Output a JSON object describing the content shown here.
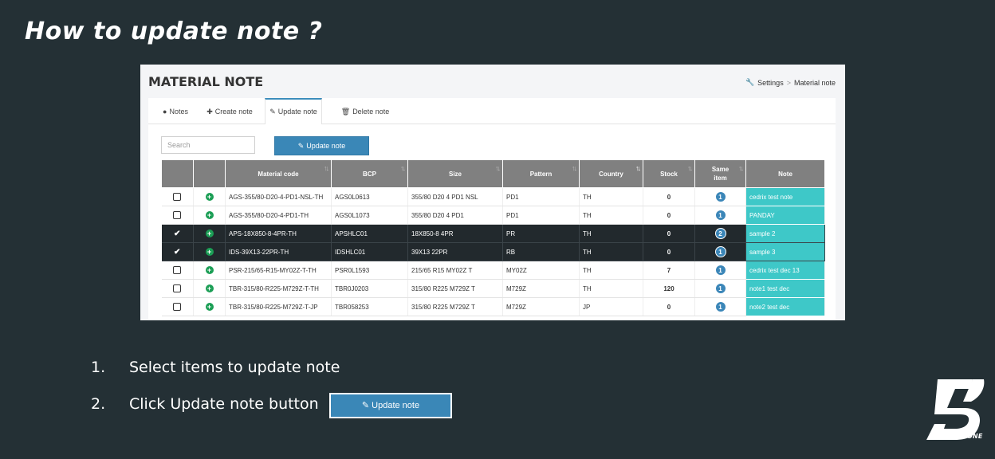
{
  "slide": {
    "title": "How to update note ?",
    "steps": [
      {
        "num": "1.",
        "text": "Select items to update note"
      },
      {
        "num": "2.",
        "text": "Click Update note button"
      }
    ],
    "sample_button_label": "Update note",
    "logo_text": "BRIDGESTONE"
  },
  "app": {
    "page_title": "MATERIAL NOTE",
    "breadcrumb": {
      "root": "Settings",
      "separator": ">",
      "current": "Material note"
    },
    "tabs": [
      {
        "label": "Notes",
        "icon": "comment-icon"
      },
      {
        "label": "Create note",
        "icon": "plus-icon"
      },
      {
        "label": "Update note",
        "icon": "edit-icon"
      },
      {
        "label": "Delete note",
        "icon": "trash-icon"
      }
    ],
    "active_tab": "Update note",
    "search": {
      "placeholder": "Search",
      "value": ""
    },
    "update_button_label": "Update note",
    "columns": [
      "",
      "",
      "Material code",
      "BCP",
      "Size",
      "Pattern",
      "Country",
      "Stock",
      "Same item",
      "Note"
    ],
    "rows": [
      {
        "selected": false,
        "material_code": "AGS-355/80-D20-4-PD1-NSL-TH",
        "bcp": "AGS0L0613",
        "size": "355/80 D20 4 PD1 NSL",
        "pattern": "PD1",
        "country": "TH",
        "stock": "0",
        "same_item": "1",
        "note": "cedrix test note"
      },
      {
        "selected": false,
        "material_code": "AGS-355/80-D20-4-PD1-TH",
        "bcp": "AGS0L1073",
        "size": "355/80 D20 4 PD1",
        "pattern": "PD1",
        "country": "TH",
        "stock": "0",
        "same_item": "1",
        "note": "PANDAY"
      },
      {
        "selected": true,
        "material_code": "APS-18X850-8-4PR-TH",
        "bcp": "APSHLC01",
        "size": "18X850-8 4PR",
        "pattern": "PR",
        "country": "TH",
        "stock": "0",
        "same_item": "2",
        "note": "sample 2"
      },
      {
        "selected": true,
        "material_code": "IDS-39X13-22PR-TH",
        "bcp": "IDSHLC01",
        "size": "39X13 22PR",
        "pattern": "RB",
        "country": "TH",
        "stock": "0",
        "same_item": "1",
        "note": "sample 3"
      },
      {
        "selected": false,
        "material_code": "PSR-215/65-R15-MY02Z-T-TH",
        "bcp": "PSR0L1593",
        "size": "215/65 R15 MY02Z T",
        "pattern": "MY02Z",
        "country": "TH",
        "stock": "7",
        "same_item": "1",
        "note": "cedrix test dec 13"
      },
      {
        "selected": false,
        "material_code": "TBR-315/80-R225-M729Z-T-TH",
        "bcp": "TBR0J0203",
        "size": "315/80 R225 M729Z T",
        "pattern": "M729Z",
        "country": "TH",
        "stock": "120",
        "same_item": "1",
        "note": "note1 test dec"
      },
      {
        "selected": false,
        "material_code": "TBR-315/80-R225-M729Z-T-JP",
        "bcp": "TBR058253",
        "size": "315/80 R225 M729Z T",
        "pattern": "M729Z",
        "country": "JP",
        "stock": "0",
        "same_item": "1",
        "note": "note2 test dec"
      }
    ]
  },
  "colors": {
    "slide_bg": "#243035",
    "primary_button": "#3a87b7",
    "note_cell": "#3ec8c8",
    "selected_row": "#22292d",
    "header_bg": "#808080",
    "add_icon": "#1b9e55"
  }
}
